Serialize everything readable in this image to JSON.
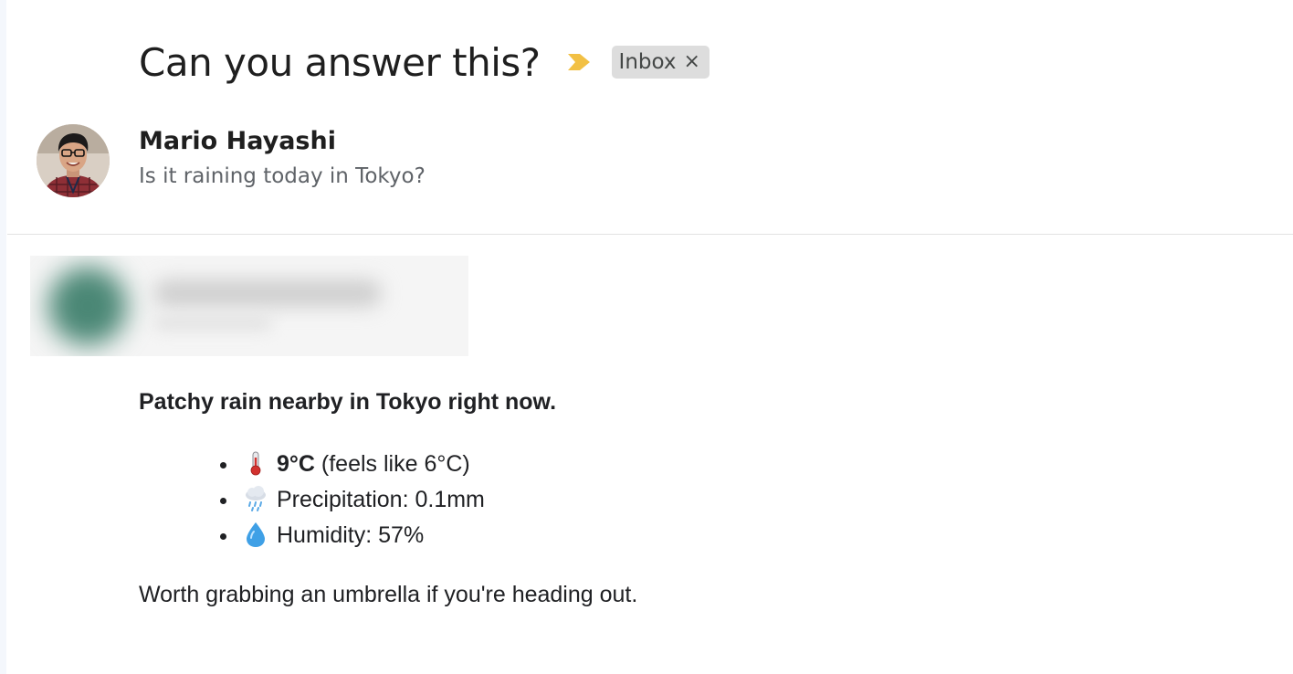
{
  "email": {
    "subject": "Can you answer this?",
    "label": {
      "name": "Inbox",
      "close": "×"
    },
    "importance_icon": "importance-marker-icon",
    "importance_color": "#f2c044"
  },
  "sender": {
    "name": "Mario Hayashi",
    "snippet": "Is it raining today in Tokyo?"
  },
  "reply": {
    "headline": "Patchy rain nearby in Tokyo right now.",
    "items": [
      {
        "icon": "thermometer-icon",
        "value": "9°C",
        "text": " (feels like 6°C)"
      },
      {
        "icon": "rain-cloud-icon",
        "text": "Precipitation: 0.1mm"
      },
      {
        "icon": "droplet-icon",
        "text": "Humidity: 57%"
      }
    ],
    "closing": "Worth grabbing an umbrella if you're heading out."
  }
}
